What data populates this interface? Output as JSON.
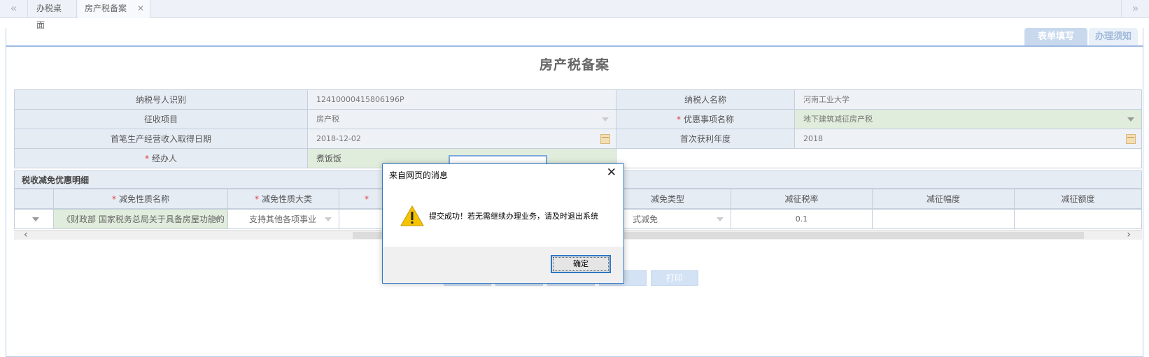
{
  "tabs": {
    "items": [
      {
        "label": "办税桌面"
      },
      {
        "label": "房产税备案",
        "close": "✕"
      }
    ],
    "nav_left": "«",
    "nav_right": "»"
  },
  "side_tabs": {
    "form_fill": "表单填写",
    "notice": "办理须知"
  },
  "page_title": "房产税备案",
  "form": {
    "taxpayer_id_label": "纳税号人识别",
    "taxpayer_id_value": "12410000415806196P",
    "taxpayer_name_label": "纳税人名称",
    "taxpayer_name_value": "河南工业大学",
    "collection_item_label": "征收项目",
    "collection_item_value": "房产税",
    "preferential_name_label": "优惠事项名称",
    "preferential_name_value": "地下建筑减征房产税",
    "first_income_date_label": "首笔生产经营收入取得日期",
    "first_income_date_value": "2018-12-02",
    "first_profit_year_label": "首次获利年度",
    "first_profit_year_value": "2018",
    "handler_label": "经办人",
    "handler_value": "煮饭饭",
    "required_mark": "*"
  },
  "section_title": "税收减免优惠明细",
  "grid": {
    "headers": [
      "减免性质名称",
      "减免性质大类",
      "",
      "减免类型",
      "减征税率",
      "减征幅度",
      "减征额度"
    ],
    "row": {
      "name": "《财政部 国家税务总局关于具备房屋功能的",
      "category": "支持其他各项事业",
      "type": "式减免",
      "rate": "0.1",
      "range": "",
      "amount": ""
    }
  },
  "background_buttons": [
    "打印"
  ],
  "dialog": {
    "title": "来自网页的消息",
    "message": "提交成功！若无需继续办理业务，请及时退出系统",
    "ok_label": "确定",
    "close": "✕"
  },
  "colors": {
    "accent": "#2f78c6",
    "label_bg": "#e6ecf4",
    "highlight_bg": "#e1eddc"
  }
}
